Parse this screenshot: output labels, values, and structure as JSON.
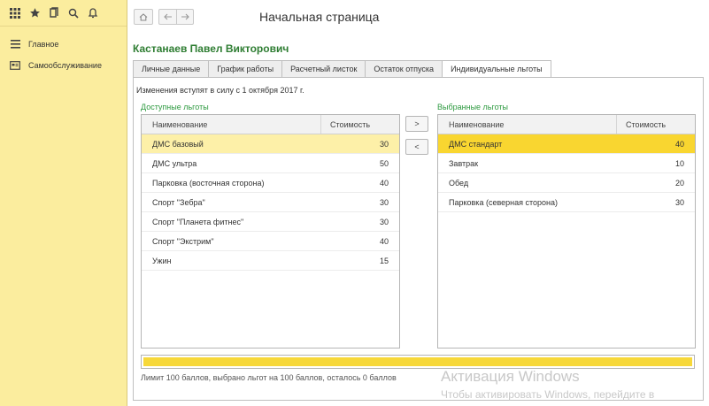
{
  "sidebar": {
    "items": [
      {
        "label": "Главное",
        "icon": "menu-lines-icon"
      },
      {
        "label": "Самообслуживание",
        "icon": "card-icon"
      }
    ]
  },
  "header": {
    "title": "Начальная страница"
  },
  "employee": {
    "name": "Кастанаев Павел Викторович"
  },
  "tabs": [
    {
      "label": "Личные данные",
      "active": false
    },
    {
      "label": "График работы",
      "active": false
    },
    {
      "label": "Расчетный листок",
      "active": false
    },
    {
      "label": "Остаток отпуска",
      "active": false
    },
    {
      "label": "Индивидуальные льготы",
      "active": true
    }
  ],
  "notice": "Изменения вступят в силу с 1 октября 2017 г.",
  "available": {
    "label": "Доступные льготы",
    "columns": [
      "Наименование",
      "Стоимость"
    ],
    "rows": [
      {
        "name": "ДМС базовый",
        "cost": "30"
      },
      {
        "name": "ДМС ультра",
        "cost": "50"
      },
      {
        "name": "Парковка (восточная сторона)",
        "cost": "40"
      },
      {
        "name": "Спорт \"Зебра\"",
        "cost": "30"
      },
      {
        "name": "Спорт \"Планета фитнес\"",
        "cost": "30"
      },
      {
        "name": "Спорт \"Экстрим\"",
        "cost": "40"
      },
      {
        "name": "Ужин",
        "cost": "15"
      }
    ]
  },
  "selected": {
    "label": "Выбранные льготы",
    "columns": [
      "Наименование",
      "Стоимость"
    ],
    "rows": [
      {
        "name": "ДМС стандарт",
        "cost": "40"
      },
      {
        "name": "Завтрак",
        "cost": "10"
      },
      {
        "name": "Обед",
        "cost": "20"
      },
      {
        "name": "Парковка (северная сторона)",
        "cost": "30"
      }
    ]
  },
  "buttons": {
    "add": ">",
    "remove": "<"
  },
  "progress": {
    "percent": 100,
    "color": "#f7d83a"
  },
  "status": "Лимит 100 баллов, выбрано льгот на 100 баллов, осталось 0 баллов",
  "watermark": {
    "line1": "Активация Windows",
    "line2": "Чтобы активировать Windows, перейдите в"
  }
}
